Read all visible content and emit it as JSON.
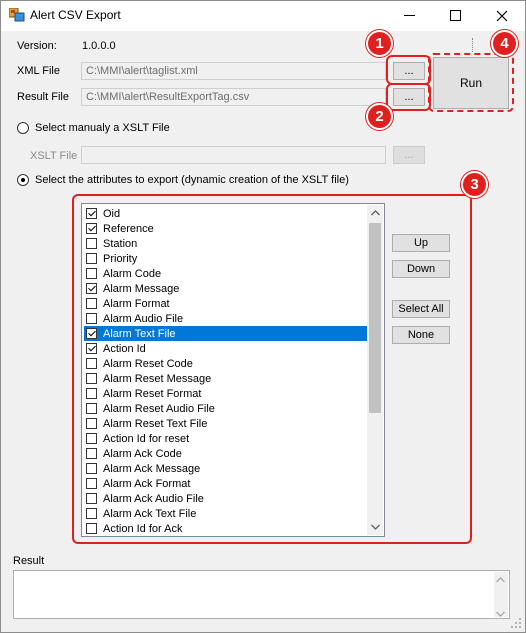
{
  "window": {
    "title": "Alert CSV Export",
    "minimize": "—",
    "maximize": "☐",
    "close": "✕"
  },
  "version": {
    "label": "Version:",
    "value": "1.0.0.0"
  },
  "xml_file": {
    "label": "XML File",
    "value": "C:\\MMI\\alert\\taglist.xml",
    "browse": "..."
  },
  "result_file": {
    "label": "Result File",
    "value": "C:\\MMI\\alert\\ResultExportTag.csv",
    "browse": "..."
  },
  "run_button": "Run",
  "radio_manual": "Select manualy a XSLT File",
  "xslt_file": {
    "label": "XSLT File",
    "value": "",
    "browse": "..."
  },
  "radio_attributes": "Select the attributes to export (dynamic creation  of the XSLT file)",
  "badges": [
    "1",
    "2",
    "3",
    "4"
  ],
  "attributes": [
    {
      "label": "Oid",
      "checked": true
    },
    {
      "label": "Reference",
      "checked": true
    },
    {
      "label": "Station",
      "checked": false
    },
    {
      "label": "Priority",
      "checked": false
    },
    {
      "label": "Alarm Code",
      "checked": false
    },
    {
      "label": "Alarm Message",
      "checked": true
    },
    {
      "label": "Alarm Format",
      "checked": false
    },
    {
      "label": "Alarm Audio File",
      "checked": false
    },
    {
      "label": "Alarm Text File",
      "checked": true,
      "selected": true
    },
    {
      "label": "Action Id",
      "checked": true
    },
    {
      "label": "Alarm Reset Code",
      "checked": false
    },
    {
      "label": "Alarm Reset Message",
      "checked": false
    },
    {
      "label": "Alarm Reset Format",
      "checked": false
    },
    {
      "label": "Alarm Reset Audio File",
      "checked": false
    },
    {
      "label": "Alarm Reset Text File",
      "checked": false
    },
    {
      "label": "Action Id for reset",
      "checked": false
    },
    {
      "label": "Alarm Ack Code",
      "checked": false
    },
    {
      "label": "Alarm Ack Message",
      "checked": false
    },
    {
      "label": "Alarm Ack Format",
      "checked": false
    },
    {
      "label": "Alarm Ack Audio File",
      "checked": false
    },
    {
      "label": "Alarm Ack Text File",
      "checked": false
    },
    {
      "label": "Action Id for Ack",
      "checked": false
    }
  ],
  "side_buttons": {
    "up": "Up",
    "down": "Down",
    "select_all": "Select All",
    "none": "None"
  },
  "result": {
    "label": "Result",
    "value": ""
  },
  "colors": {
    "annotation": "#e0201e",
    "selection": "#0078d7"
  }
}
